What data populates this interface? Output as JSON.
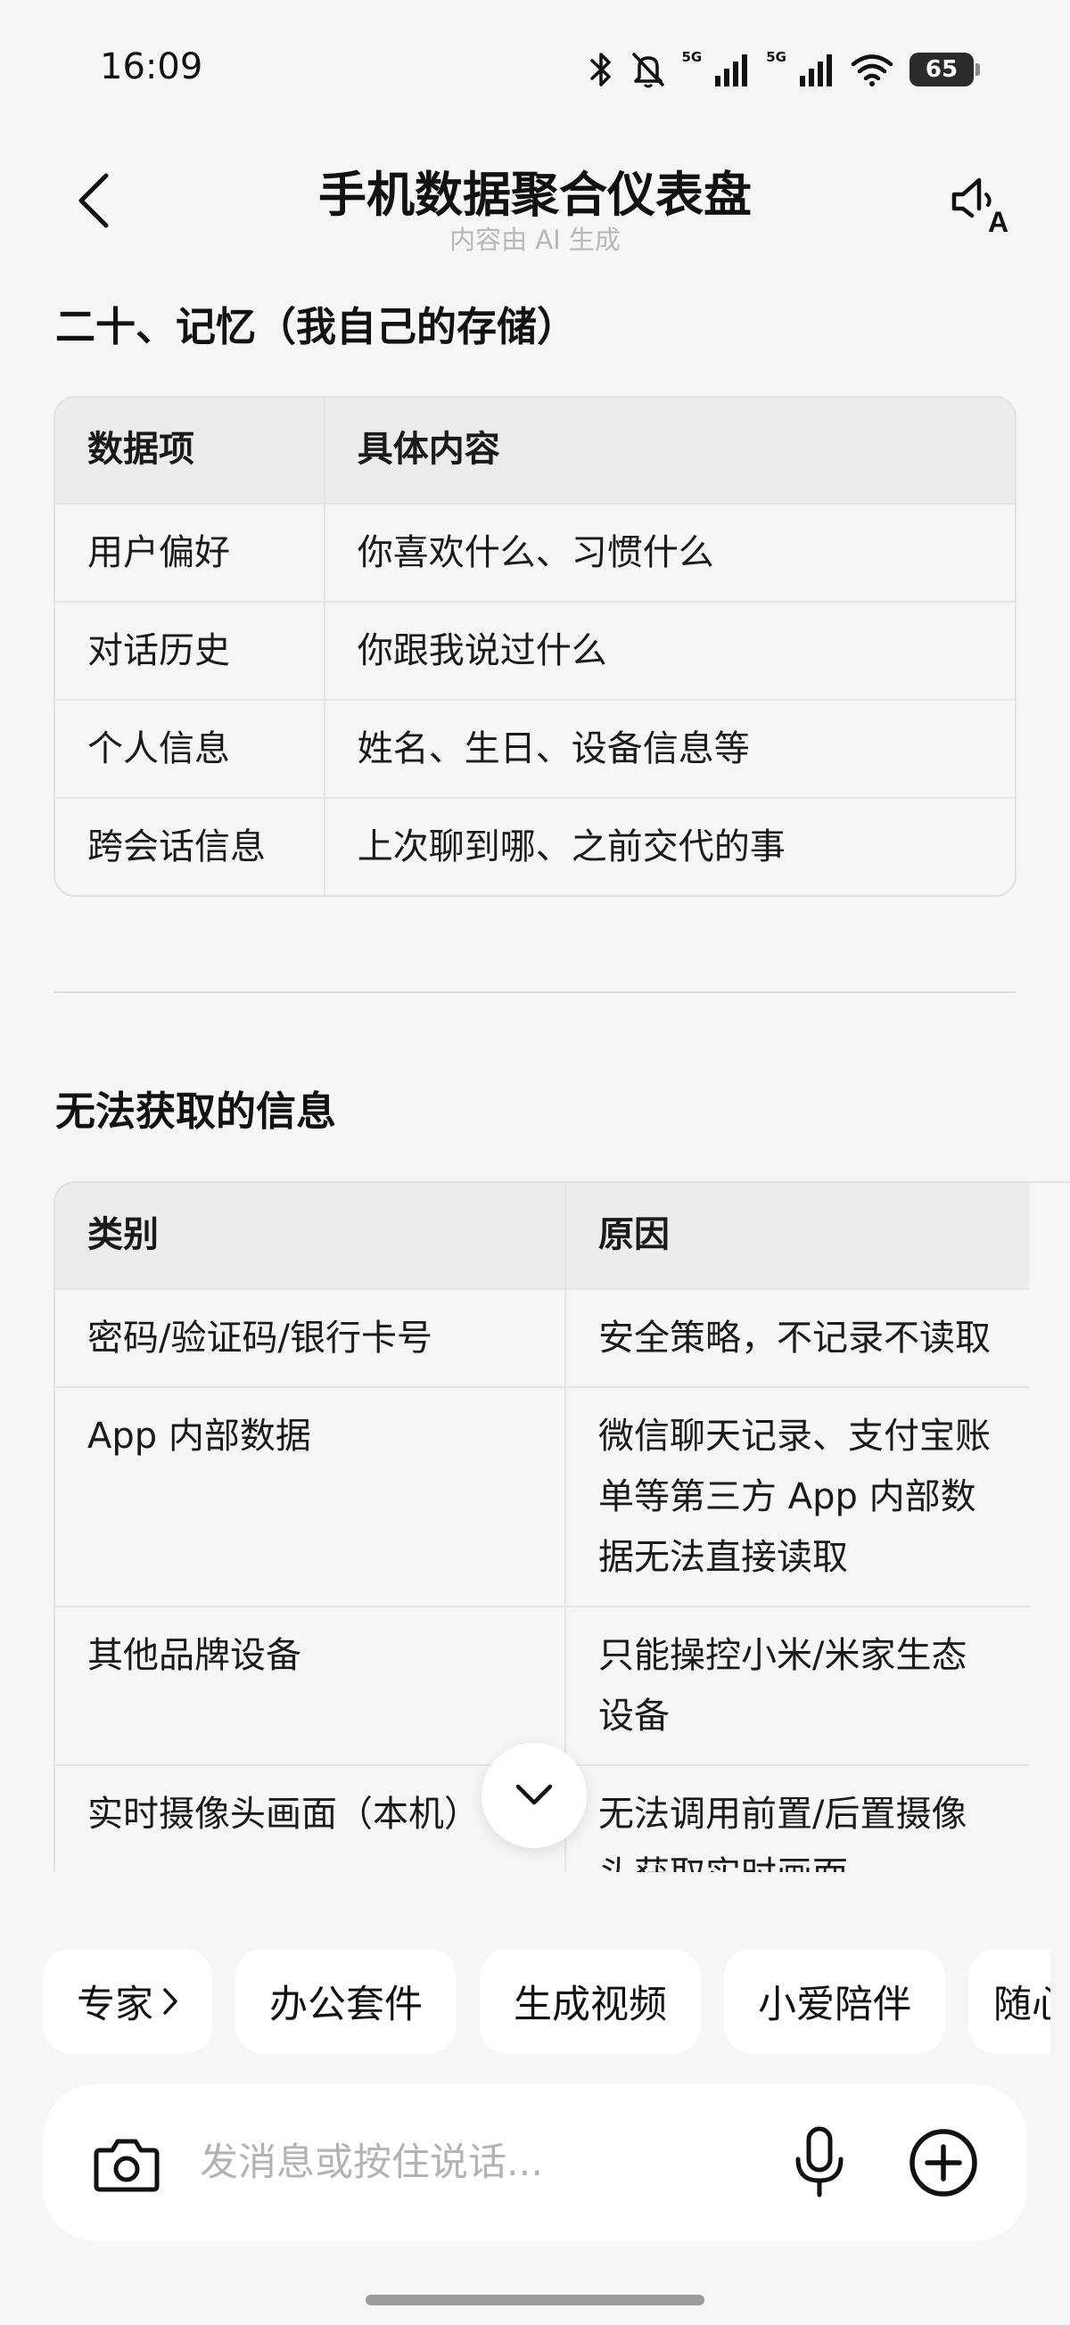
{
  "status_bar": {
    "time": "16:09",
    "network_1": "5G",
    "network_2": "5G",
    "battery_level": "65"
  },
  "header": {
    "title": "手机数据聚合仪表盘",
    "subtitle": "内容由 AI 生成"
  },
  "section_memory": {
    "heading": "二十、记忆（我自己的存储）",
    "columns": [
      "数据项",
      "具体内容"
    ],
    "rows": [
      [
        "用户偏好",
        "你喜欢什么、习惯什么"
      ],
      [
        "对话历史",
        "你跟我说过什么"
      ],
      [
        "个人信息",
        "姓名、生日、设备信息等"
      ],
      [
        "跨会话信息",
        "上次聊到哪、之前交代的事"
      ]
    ]
  },
  "section_unavailable": {
    "heading": "无法获取的信息",
    "columns": [
      "类别",
      "原因"
    ],
    "rows": [
      [
        "密码/验证码/银行卡号",
        "安全策略，不记录不读取"
      ],
      [
        "App 内部数据",
        "微信聊天记录、支付宝账单等第三方 App 内部数据无法直接读取"
      ],
      [
        "其他品牌设备",
        "只能操控小米/米家生态设备"
      ],
      [
        "实时摄像头画面（本机）",
        "无法调用前置/后置摄像头获取实时画面"
      ]
    ]
  },
  "chips": [
    {
      "label": "专家"
    },
    {
      "label": "办公套件"
    },
    {
      "label": "生成视频"
    },
    {
      "label": "小爱陪伴"
    },
    {
      "label": "随心"
    }
  ],
  "input": {
    "placeholder": "发消息或按住说话..."
  },
  "icons": {
    "bluetooth": "bluetooth-icon",
    "mute": "bell-off-icon",
    "signal": "signal-icon",
    "wifi": "wifi-icon",
    "back": "chevron-left-icon",
    "read_aloud": "speaker-a-icon",
    "scroll_down": "chevron-down-icon",
    "camera": "camera-icon",
    "mic": "microphone-icon",
    "add": "plus-circle-icon"
  }
}
